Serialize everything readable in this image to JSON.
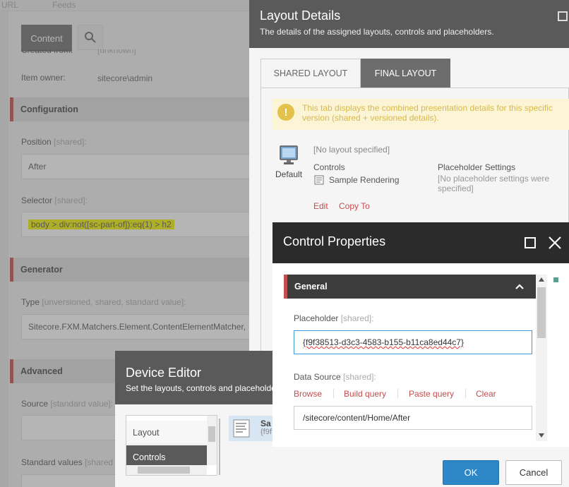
{
  "background": {
    "top_tabs": [
      "URL",
      "Feeds"
    ],
    "content_button": "Content",
    "created_from_label": "Created from:",
    "created_from_value": "[unknown]",
    "item_owner_label": "Item owner:",
    "item_owner_value": "sitecore\\admin",
    "configuration_section": "Configuration",
    "position_label": "Position",
    "position_note": "[shared]:",
    "position_value": "After",
    "selector_label": "Selector",
    "selector_note": "[shared]:",
    "selector_value": "body > div:not([sc-part-of]):eq(1) > h2",
    "generator_section": "Generator",
    "type_label": "Type",
    "type_note": "[unversioned, shared, standard value]:",
    "type_value": "Sitecore.FXM.Matchers.Element.ContentElementMatcher,",
    "advanced_section": "Advanced",
    "source_label": "Source",
    "source_note": "[standard value]:",
    "standard_values_label": "Standard values",
    "standard_values_note": "[shared"
  },
  "layout_details": {
    "title": "Layout Details",
    "subtitle": "The details of the assigned layouts, controls and placeholders.",
    "tabs": [
      "SHARED LAYOUT",
      "FINAL LAYOUT"
    ],
    "active_tab": "FINAL LAYOUT",
    "warning": "This tab displays the combined presentation details for this specific version (shared + versioned details).",
    "device_name": "Default",
    "layout_text": "[No layout specified]",
    "controls_label": "Controls",
    "control_item": "Sample Rendering",
    "placeholder_settings_label": "Placeholder Settings",
    "placeholder_settings_value": "[No placeholder settings were specified]",
    "edit_link": "Edit",
    "copy_to_link": "Copy To"
  },
  "device_editor": {
    "title": "Device Editor",
    "subtitle": "Set the layouts, controls and placeholders",
    "items": [
      "Layout",
      "Controls"
    ],
    "selected_item": "Controls",
    "rendering_label": "Sa",
    "rendering_sub": "{f9f"
  },
  "control_properties": {
    "title": "Control Properties",
    "section": "General",
    "placeholder_label": "Placeholder",
    "placeholder_note": "[shared]:",
    "placeholder_value": "{f9f38513-d3c3-4583-b155-b11ca8ed44c7}",
    "data_source_label": "Data Source",
    "data_source_note": "[shared]:",
    "ds_links": [
      "Browse",
      "Build query",
      "Paste query",
      "Clear"
    ],
    "data_source_value": "/sitecore/content/Home/After",
    "ok_label": "OK",
    "cancel_label": "Cancel"
  },
  "colors": {
    "accent_red": "#c34e4e",
    "primary_blue": "#2e87c7",
    "highlight_yellow": "#f5f300",
    "dialog_header_dark": "#2b2b2b",
    "dialog_header_grey": "#5a5a5a"
  }
}
